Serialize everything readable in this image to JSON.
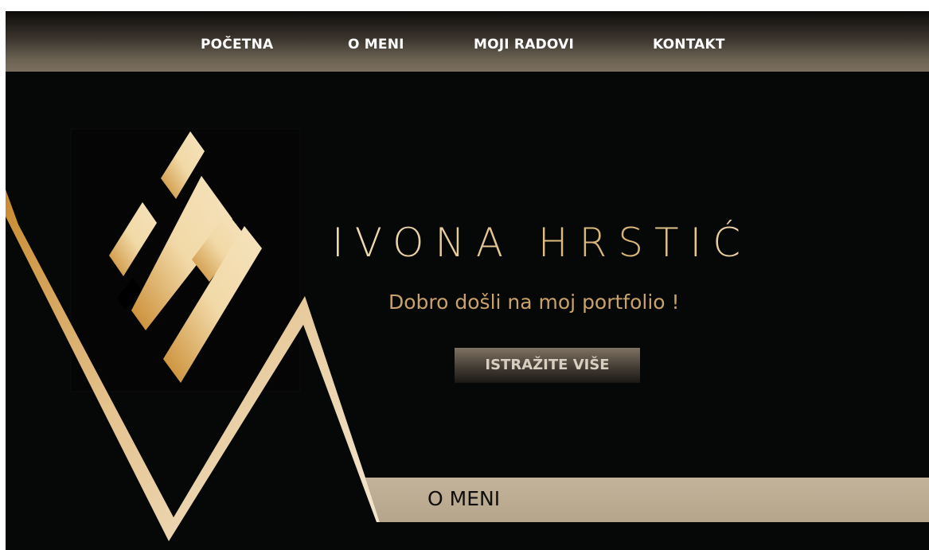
{
  "nav": {
    "items": [
      {
        "label": "POČETNA"
      },
      {
        "label": "O MENI"
      },
      {
        "label": "MOJI RADOVI"
      },
      {
        "label": "KONTAKT"
      }
    ]
  },
  "hero": {
    "name": "IVONA HRSTIĆ",
    "subtitle": "Dobro došli na moj portfolio !",
    "cta_label": "ISTRAŽITE VIŠE"
  },
  "section": {
    "about_label": "O MENI"
  },
  "colors": {
    "background": "#060807",
    "gold": "#d4a95e",
    "band": "#bcac93",
    "nav_bottom": "#7b705f"
  },
  "icons": {
    "logo": "ih-monogram-logo"
  }
}
